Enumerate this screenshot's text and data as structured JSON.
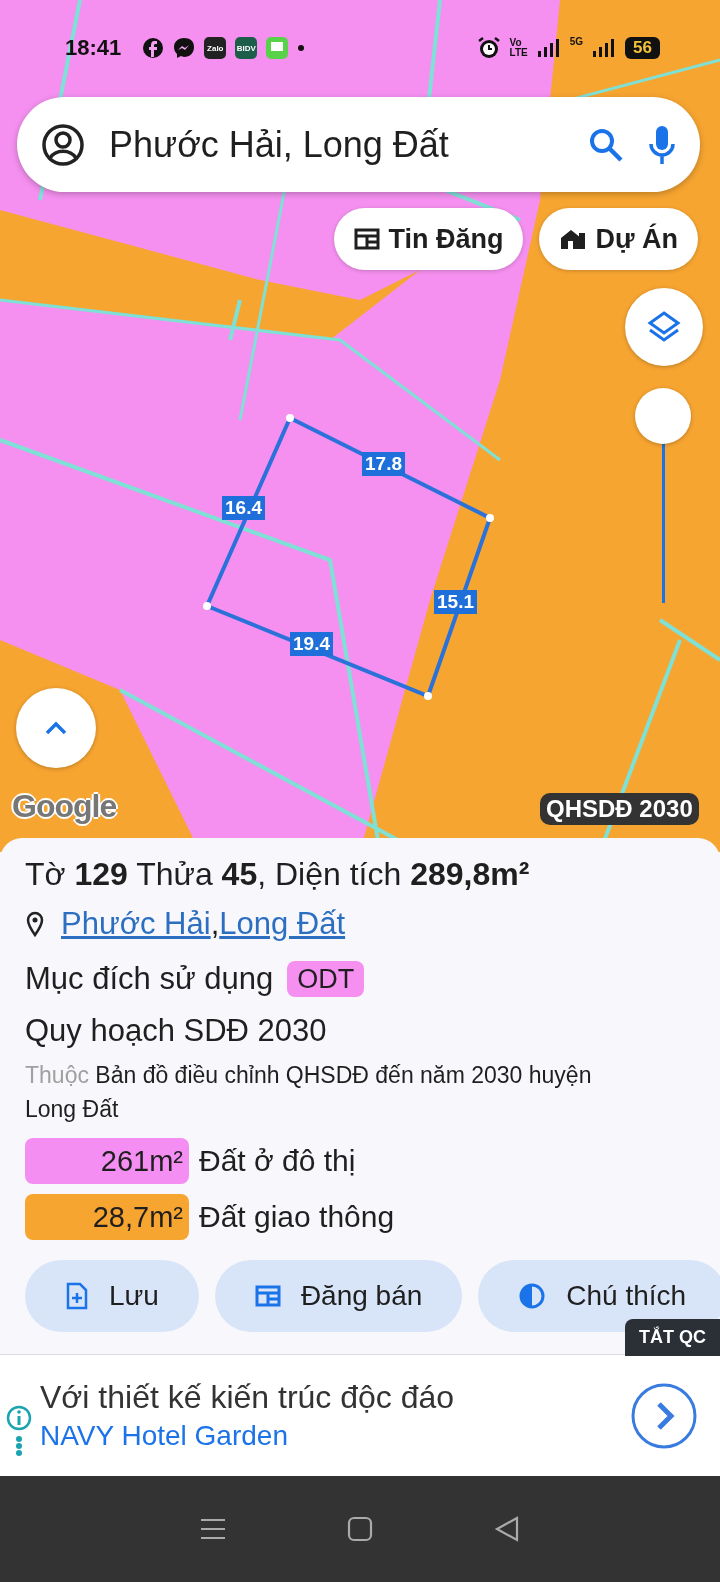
{
  "status_bar": {
    "time": "18:41",
    "app_icons": [
      {
        "kind": "facebook"
      },
      {
        "kind": "messenger"
      },
      {
        "kind": "zalo",
        "label": "Zalo"
      },
      {
        "kind": "bank",
        "label": "BIDV"
      },
      {
        "kind": "chat"
      }
    ],
    "volte_top": "Vo",
    "volte_bottom": "LTE",
    "network": "5G",
    "battery": "56"
  },
  "search": {
    "value": "Phước Hải, Long Đất"
  },
  "chips": [
    {
      "label": "Tin Đăng",
      "kind": "listing"
    },
    {
      "label": "Dự Án",
      "kind": "house"
    }
  ],
  "map": {
    "parcel_edges": [
      {
        "label": "17.8"
      },
      {
        "label": "15.1"
      },
      {
        "label": "19.4"
      },
      {
        "label": "16.4"
      }
    ],
    "opacity_slider": {
      "level": 1
    },
    "attribution": "Google",
    "layer_label": "QHSDĐ 2030"
  },
  "panel": {
    "title": "Tờ **129** Thửa **45**, Diện tích **289,8m²**",
    "location_links": [
      "Phước Hải",
      "Long Đất"
    ],
    "location_separator": ",",
    "purpose_label": "Mục đích sử dụng",
    "purpose_code": "ODT",
    "plan_title": "Quy hoạch SDĐ 2030",
    "source_prefix": "Thuộc",
    "source_text": "Bản đồ điều chỉnh QHSDĐ đến năm 2030 huyện Long Đất",
    "legend": [
      {
        "area": "261m²",
        "label": "Đất ở đô thị",
        "color": "#f58ef2"
      },
      {
        "area": "28,7m²",
        "label": "Đất giao thông",
        "color": "#f7a531"
      }
    ],
    "actions": [
      {
        "label": "Lưu",
        "kind": "save"
      },
      {
        "label": "Đăng bán",
        "kind": "listing"
      },
      {
        "label": "Chú thích",
        "kind": "contrast"
      }
    ]
  },
  "ad": {
    "close_label": "TẮT QC",
    "headline": "Với thiết kế kiến trúc độc đáo",
    "advertiser": "NAVY Hotel Garden"
  }
}
